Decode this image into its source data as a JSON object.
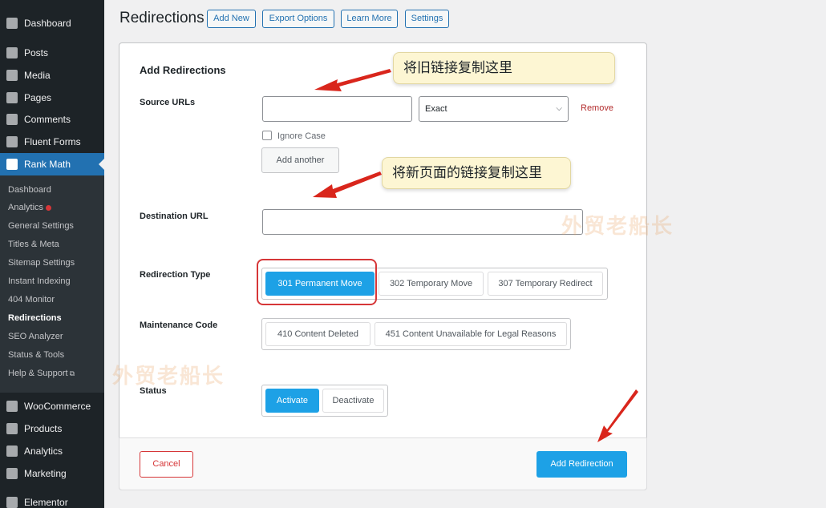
{
  "sidebar": {
    "items": [
      {
        "label": "Dashboard",
        "icon": "dashboard-icon"
      },
      {
        "label": "Posts",
        "icon": "pin-icon"
      },
      {
        "label": "Media",
        "icon": "media-icon"
      },
      {
        "label": "Pages",
        "icon": "pages-icon"
      },
      {
        "label": "Comments",
        "icon": "comment-icon"
      },
      {
        "label": "Fluent Forms",
        "icon": "form-icon"
      },
      {
        "label": "Rank Math",
        "icon": "rank-math-icon"
      }
    ],
    "submenu": [
      {
        "label": "Dashboard"
      },
      {
        "label": "Analytics"
      },
      {
        "label": "General Settings"
      },
      {
        "label": "Titles & Meta"
      },
      {
        "label": "Sitemap Settings"
      },
      {
        "label": "Instant Indexing"
      },
      {
        "label": "404 Monitor"
      },
      {
        "label": "Redirections"
      },
      {
        "label": "SEO Analyzer"
      },
      {
        "label": "Status & Tools"
      },
      {
        "label": "Help & Support"
      }
    ],
    "bottom_items": [
      {
        "label": "WooCommerce",
        "icon": "woo-icon"
      },
      {
        "label": "Products",
        "icon": "products-icon"
      },
      {
        "label": "Analytics",
        "icon": "bar-chart-icon"
      },
      {
        "label": "Marketing",
        "icon": "megaphone-icon"
      },
      {
        "label": "Elementor",
        "icon": "elementor-icon"
      }
    ]
  },
  "header": {
    "title": "Redirections",
    "buttons": [
      "Add New",
      "Export Options",
      "Learn More",
      "Settings"
    ]
  },
  "form": {
    "title": "Add Redirections",
    "source_label": "Source URLs",
    "source_value": "",
    "match_type": "Exact",
    "remove_label": "Remove",
    "ignore_case_label": "Ignore Case",
    "add_another_label": "Add another",
    "destination_label": "Destination URL",
    "destination_value": "",
    "redirection_type_label": "Redirection Type",
    "redirection_types": [
      "301 Permanent Move",
      "302 Temporary Move",
      "307 Temporary Redirect"
    ],
    "maintenance_label": "Maintenance Code",
    "maintenance_codes": [
      "410 Content Deleted",
      "451 Content Unavailable for Legal Reasons"
    ],
    "status_label": "Status",
    "status_options": [
      "Activate",
      "Deactivate"
    ],
    "cancel_label": "Cancel",
    "submit_label": "Add Redirection"
  },
  "annotations": {
    "callout_source": "将旧链接复制这里",
    "callout_destination": "将新页面的链接复制这里"
  },
  "watermark": "外贸老船长",
  "colors": {
    "accent": "#1da1e6",
    "sidebar_bg": "#1d2327",
    "current_menu": "#2271b1",
    "danger": "#d63638",
    "annotation_arrow": "#d9261c"
  }
}
